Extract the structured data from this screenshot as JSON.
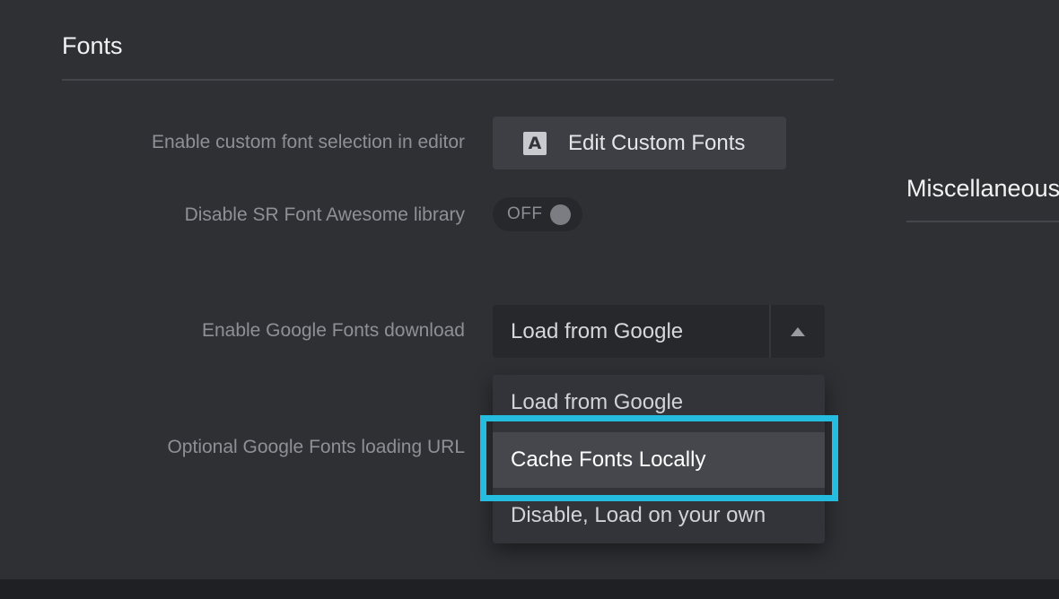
{
  "fonts_section": {
    "title": "Fonts"
  },
  "misc_section": {
    "title": "Miscellaneous"
  },
  "settings": {
    "custom_font": {
      "label": "Enable custom font selection in editor",
      "button_label": "Edit Custom Fonts",
      "icon": "font-letter-a-icon"
    },
    "font_awesome": {
      "label": "Disable SR Font Awesome library",
      "toggle_state": "OFF"
    },
    "google_fonts": {
      "label": "Enable Google Fonts download",
      "selected_value": "Load from Google",
      "options": [
        "Load from Google",
        "Cache Fonts Locally",
        "Disable, Load on your own"
      ],
      "highlighted_option": "Cache Fonts Locally"
    },
    "google_url": {
      "label": "Optional Google Fonts loading URL"
    }
  },
  "colors": {
    "background": "#2f3034",
    "highlight": "#24bde0",
    "control_bg": "#27282c"
  }
}
